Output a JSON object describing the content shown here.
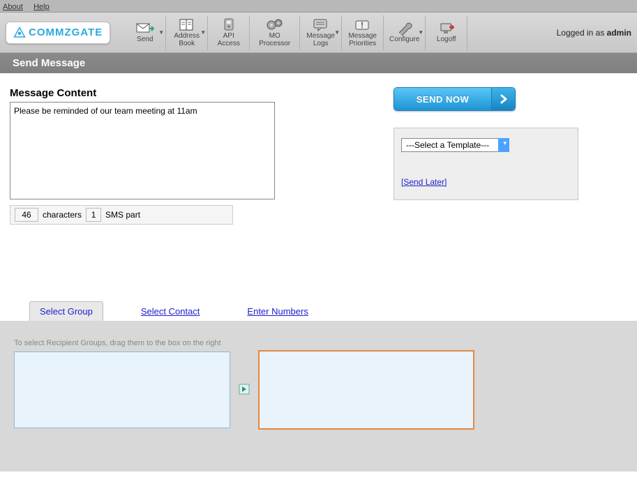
{
  "topnav": {
    "about": "About",
    "help": "Help"
  },
  "brand": "COMMZGATE",
  "toolbar": {
    "send": "Send",
    "addressbook_l1": "Address",
    "addressbook_l2": "Book",
    "api_l1": "API",
    "api_l2": "Access",
    "mo_l1": "MO",
    "mo_l2": "Processor",
    "msglogs_l1": "Message",
    "msglogs_l2": "Logs",
    "msgprio_l1": "Message",
    "msgprio_l2": "Priorities",
    "configure": "Configure",
    "logoff": "Logoff"
  },
  "user_prefix": "Logged in as ",
  "user_name": "admin",
  "page_title": "Send Message",
  "section_title": "Message Content",
  "message_text": "Please be reminded of our team meeting at 11am",
  "char_count": "46",
  "char_label": "characters",
  "parts_count": "1",
  "parts_label": "SMS part",
  "send_now": "SEND NOW",
  "template_placeholder": "---Select a Template---",
  "send_later": "[Send Later]",
  "tabs": {
    "select_group": "Select Group",
    "select_contact": "Select Contact",
    "enter_numbers": "Enter Numbers"
  },
  "drag_hint": "To select Recipient Groups, drag them to the box on the right"
}
